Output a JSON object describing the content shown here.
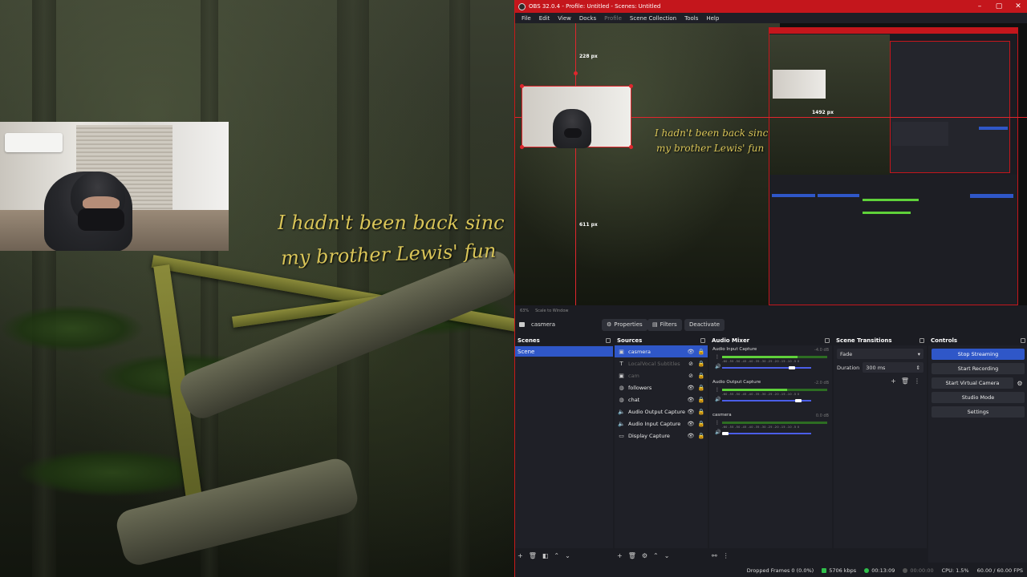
{
  "game": {
    "subtitle_line1": "I hadn't been back sinc",
    "subtitle_line2": "my brother Lewis' fun"
  },
  "window": {
    "title": "OBS 32.0.4 - Profile: Untitled - Scenes: Untitled",
    "controls": [
      "–",
      "▢",
      "✕"
    ]
  },
  "menu": [
    "File",
    "Edit",
    "View",
    "Docks",
    "Profile",
    "Scene Collection",
    "Tools",
    "Help"
  ],
  "preview": {
    "dim_top": "228 px",
    "dim_right": "1492 px",
    "dim_bottom": "611 px",
    "subtitle_line1": "I hadn't been back sinc",
    "subtitle_line2": "my brother Lewis' fun",
    "zoom": "63%",
    "scale_label": "Scale to Window"
  },
  "source_bar": {
    "selected_source": "casmera",
    "properties_label": "Properties",
    "filters_label": "Filters",
    "deactivate_label": "Deactivate"
  },
  "scenes": {
    "title": "Scenes",
    "items": [
      "Scene"
    ]
  },
  "sources": {
    "title": "Sources",
    "items": [
      {
        "name": "casmera",
        "icon": "camera-icon",
        "state": "selected"
      },
      {
        "name": "LocalVocal Subtitles",
        "icon": "text-icon",
        "state": "hidden"
      },
      {
        "name": "cam",
        "icon": "camera-icon",
        "state": "hidden"
      },
      {
        "name": "followers",
        "icon": "browser-icon",
        "state": "visible"
      },
      {
        "name": "chat",
        "icon": "browser-icon",
        "state": "visible"
      },
      {
        "name": "Audio Output Capture",
        "icon": "speaker-icon",
        "state": "visible"
      },
      {
        "name": "Audio Input Capture",
        "icon": "speaker-icon",
        "state": "visible"
      },
      {
        "name": "Display Capture",
        "icon": "monitor-icon",
        "state": "visible"
      }
    ]
  },
  "audio_mixer": {
    "title": "Audio Mixer",
    "ticks": "-60 -55 -50 -45 -40 -35 -30 -25 -20 -15 -10 -5 0",
    "channels": [
      {
        "name": "Audio Input Capture",
        "db": "-4.0 dB",
        "level": 0.72,
        "volume": 0.78
      },
      {
        "name": "Audio Output Capture",
        "db": "-2.0 dB",
        "level": 0.62,
        "volume": 0.86
      },
      {
        "name": "casmera",
        "db": "0.0 dB",
        "level": 0.0,
        "volume": 0.04
      }
    ]
  },
  "transitions": {
    "title": "Scene Transitions",
    "selected": "Fade",
    "duration_label": "Duration",
    "duration_value": "300 ms"
  },
  "controls": {
    "title": "Controls",
    "buttons": [
      "Stop Streaming",
      "Start Recording",
      "Start Virtual Camera",
      "Studio Mode",
      "Settings"
    ]
  },
  "status": {
    "dropped_frames": "Dropped Frames 0 (0.0%)",
    "bitrate": "5706 kbps",
    "stream_time": "00:13:09",
    "rec_time": "00:00:00",
    "cpu": "CPU: 1.5%",
    "fps": "60.00 / 60.00 FPS"
  },
  "colors": {
    "accent": "#2f57c8",
    "titlebar": "#c4161c",
    "subtitle": "#d8c458",
    "live": "#2fbf4a"
  }
}
